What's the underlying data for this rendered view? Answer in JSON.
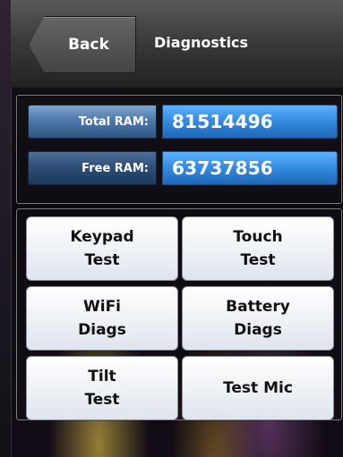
{
  "header": {
    "back_label": "Back",
    "title": "Diagnostics"
  },
  "ram": {
    "total_label": "Total RAM:",
    "total_value": "81514496",
    "free_label": "Free RAM:",
    "free_value": "63737856"
  },
  "tests": {
    "keypad": {
      "line1": "Keypad",
      "line2": "Test"
    },
    "touch": {
      "line1": "Touch",
      "line2": "Test"
    },
    "wifi": {
      "line1": "WiFi",
      "line2": "Diags"
    },
    "battery": {
      "line1": "Battery",
      "line2": "Diags"
    },
    "tilt": {
      "line1": "Tilt",
      "line2": "Test"
    },
    "mic": {
      "label": "Test Mic"
    }
  }
}
